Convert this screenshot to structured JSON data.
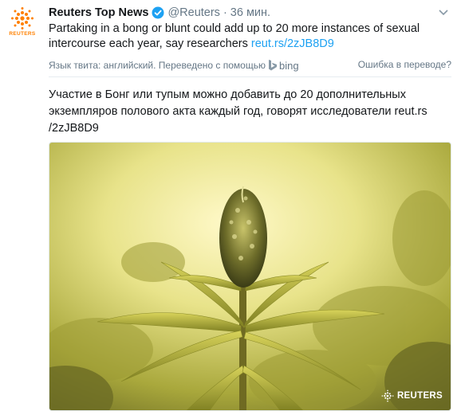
{
  "tweet": {
    "author_name": "Reuters Top News",
    "handle": "@Reuters",
    "separator": "·",
    "time": "36 мин.",
    "text_main": "Partaking in a bong or blunt could add up to 20 more instances of sexual intercourse each year, say researchers ",
    "text_link": "reut.rs/2zJB8D9",
    "avatar_brand": "REUTERS"
  },
  "translation": {
    "info": "Язык твита: английский. Переведено с помощью",
    "service": "bing",
    "mistake_link": "Ошибка в переводе?",
    "text": "Участие в Бонг или тупым можно добавить до 20 дополнительных экземпляров полового акта каждый год, говорят исследователи reut.rs /2zJB8D9"
  },
  "media": {
    "watermark": "REUTERS"
  },
  "icons": {
    "verified": "verified-badge-icon",
    "caret": "chevron-down-icon",
    "bing": "bing-logo-icon"
  },
  "colors": {
    "link": "#1da1f2",
    "secondary_text": "#657786",
    "reuters_orange": "#ff8000"
  }
}
